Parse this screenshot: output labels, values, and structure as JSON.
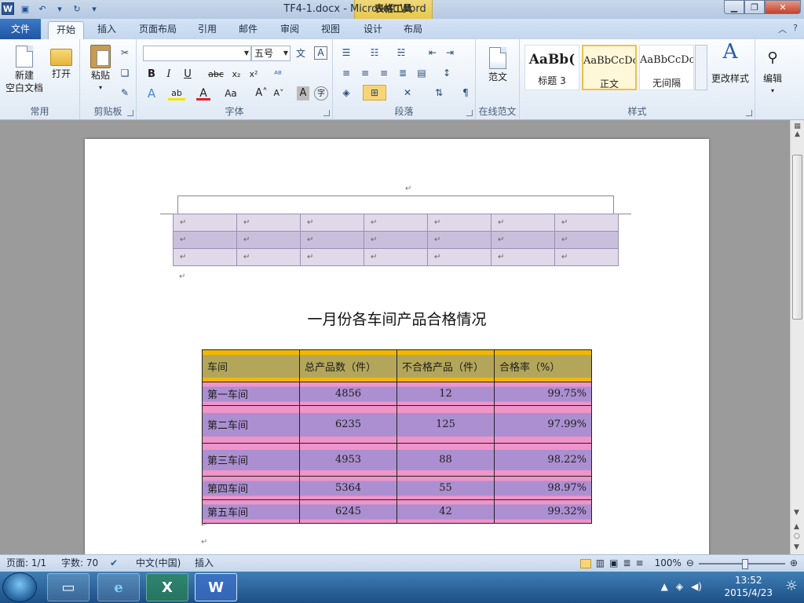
{
  "window": {
    "title": "TF4-1.docx - Microsoft Word",
    "context_tools": "表格工具"
  },
  "tabs": [
    "文件",
    "开始",
    "插入",
    "页面布局",
    "引用",
    "邮件",
    "审阅",
    "视图",
    "设计",
    "布局"
  ],
  "ribbon": {
    "group_common": "常用",
    "new_doc_l1": "新建",
    "new_doc_l2": "空白文档",
    "open": "打开",
    "paste": "粘贴",
    "group_clipboard": "剪贴板",
    "font_name": "",
    "font_size": "五号",
    "group_font": "字体",
    "group_paragraph": "段落",
    "sample_doc": "范文",
    "group_online": "在线范文",
    "styles": [
      {
        "sample": "AaBb(",
        "name": "标题 3"
      },
      {
        "sample": "AaBbCcDc",
        "name": "正文"
      },
      {
        "sample": "AaBbCcDc",
        "name": "无间隔"
      }
    ],
    "change_styles": "更改样式",
    "group_styles": "样式",
    "edit": "编辑"
  },
  "document": {
    "title": "一月份各车间产品合格情况",
    "headers": [
      "车间",
      "总产品数（件）",
      "不合格产品（件）",
      "合格率（%）"
    ],
    "rows": [
      [
        "第一车间",
        "4856",
        "12",
        "99.75%"
      ],
      [
        "第二车间",
        "6235",
        "125",
        "97.99%"
      ],
      [
        "第三车间",
        "4953",
        "88",
        "98.22%"
      ],
      [
        "第四车间",
        "5364",
        "55",
        "98.97%"
      ],
      [
        "第五车间",
        "6245",
        "42",
        "99.32%"
      ]
    ]
  },
  "status": {
    "page": "页面: 1/1",
    "words": "字数: 70",
    "language": "中文(中国)",
    "mode": "插入",
    "zoom": "100%"
  },
  "taskbar": {
    "time": "13:52",
    "date": "2015/4/23"
  }
}
